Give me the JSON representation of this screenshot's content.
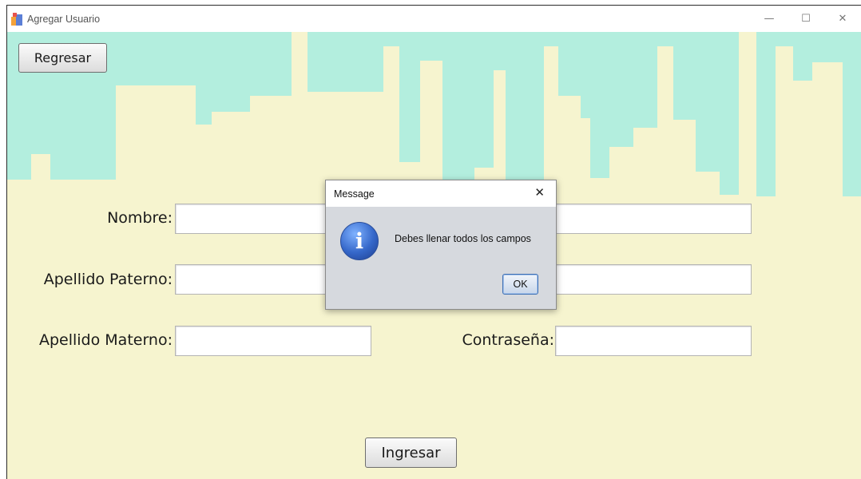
{
  "window": {
    "title": "Agregar Usuario",
    "controls": {
      "minimize": "—",
      "maximize": "☐",
      "close": "✕"
    }
  },
  "toolbar": {
    "back_label": "Regresar"
  },
  "form": {
    "nombre_label": "Nombre:",
    "apellido_paterno_label": "Apellido Paterno:",
    "apellido_materno_label": "Apellido Materno:",
    "contrasena_label": "Contraseña:",
    "nombre_value": "",
    "apellido_paterno_value": "",
    "apellido_materno_value": "",
    "right_field_1_value": "",
    "right_field_2_value": "",
    "contrasena_value": "",
    "submit_label": "Ingresar"
  },
  "dialog": {
    "title": "Message",
    "close_glyph": "✕",
    "icon": "info-icon",
    "icon_glyph": "i",
    "message": "Debes llenar todos los campos",
    "ok_label": "OK"
  },
  "colors": {
    "background": "#f6f4cf",
    "skyline": "#b3eede",
    "dialog_bg": "#d6d9de",
    "info_icon": "#3567c9"
  }
}
